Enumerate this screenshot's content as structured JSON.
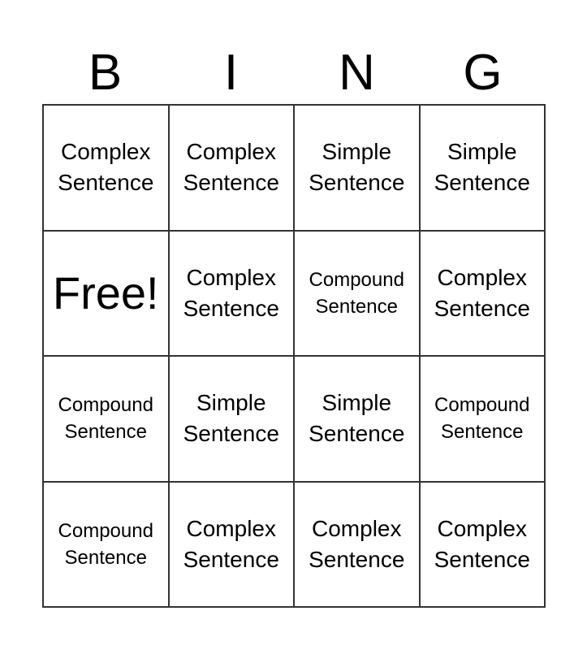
{
  "header": [
    "B",
    "I",
    "N",
    "G"
  ],
  "cells": [
    [
      "Complex\nSentence",
      "Complex\nSentence",
      "Simple\nSentence",
      "Simple\nSentence"
    ],
    [
      "Free!",
      "Complex\nSentence",
      "Compound\nSentence",
      "Complex\nSentence"
    ],
    [
      "Compound\nSentence",
      "Simple\nSentence",
      "Simple\nSentence",
      "Compound\nSentence"
    ],
    [
      "Compound\nSentence",
      "Complex\nSentence",
      "Complex\nSentence",
      "Complex\nSentence"
    ]
  ]
}
